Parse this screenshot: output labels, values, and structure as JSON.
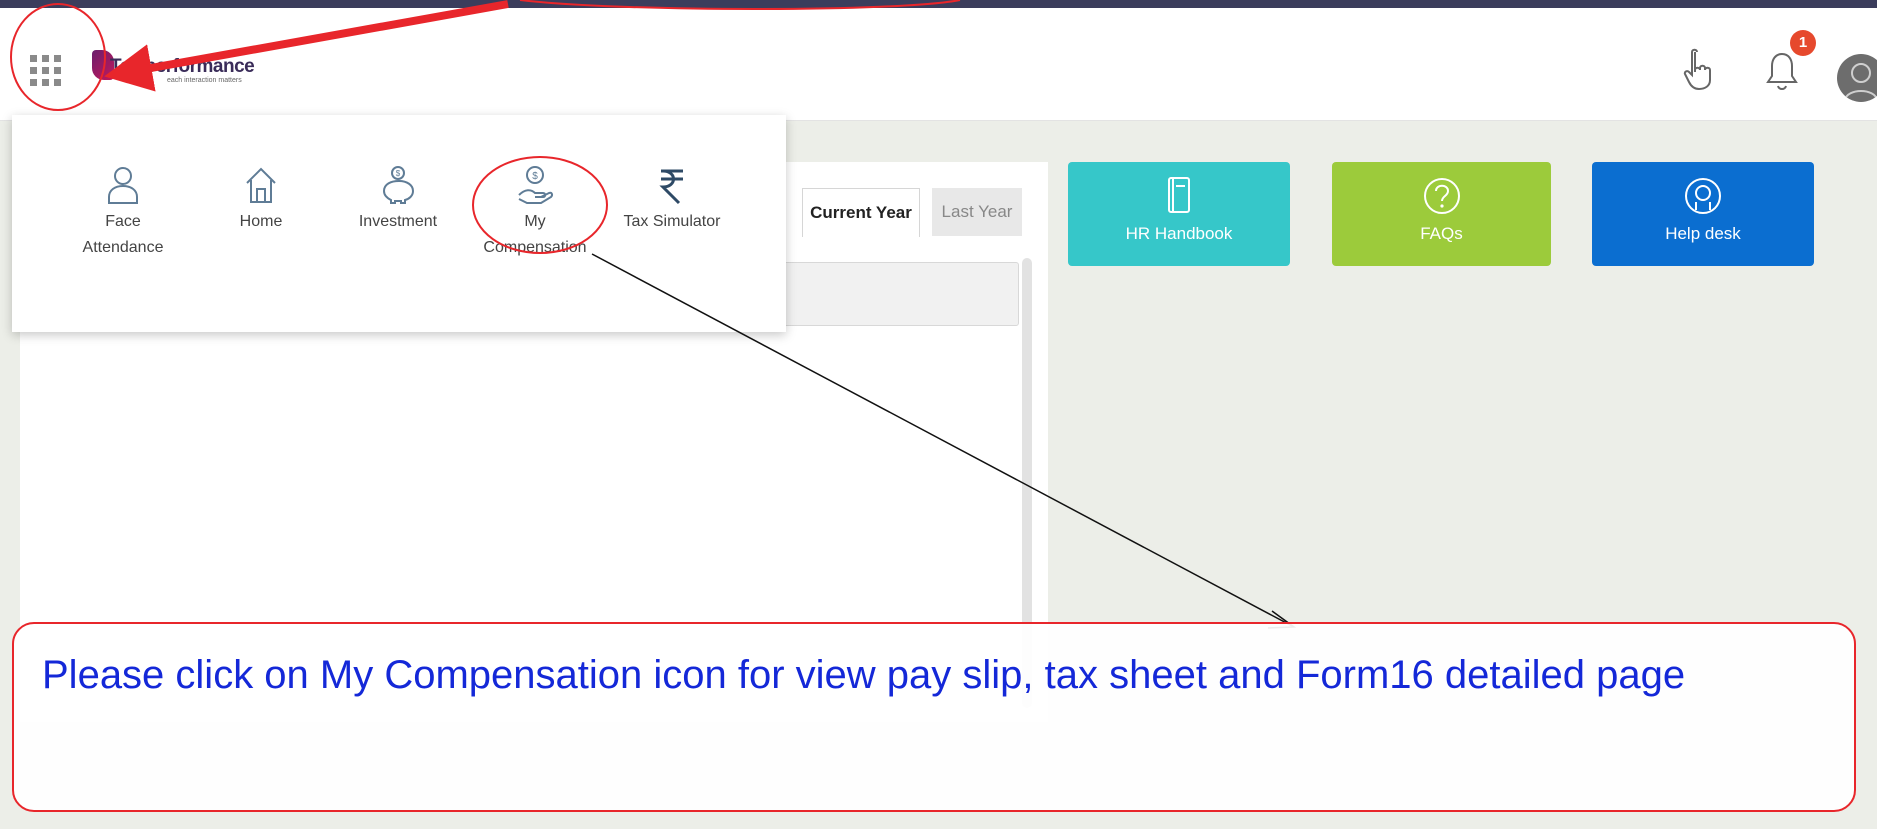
{
  "header": {
    "logo_text": "Teleperformance",
    "logo_tagline": "each interaction matters",
    "notification_count": "1"
  },
  "app_menu": {
    "items": [
      {
        "label_line1": "Face",
        "label_line2": "Attendance",
        "icon": "person-icon"
      },
      {
        "label_line1": "Home",
        "label_line2": "",
        "icon": "home-icon"
      },
      {
        "label_line1": "Investment",
        "label_line2": "",
        "icon": "piggy-bank-icon"
      },
      {
        "label_line1": "My",
        "label_line2": "Compensation",
        "icon": "hand-coin-icon"
      },
      {
        "label_line1": "Tax Simulator",
        "label_line2": "",
        "icon": "rupee-icon"
      }
    ]
  },
  "tabs": {
    "current_year": "Current Year",
    "last_year": "Last Year"
  },
  "tiles": [
    {
      "label": "HR Handbook",
      "icon": "book-icon",
      "color": "#36c7c9"
    },
    {
      "label": "FAQs",
      "icon": "question-icon",
      "color": "#9ccb3b"
    },
    {
      "label": "Help desk",
      "icon": "support-icon",
      "color": "#0b6ed0"
    }
  ],
  "callout": {
    "text": "Please click on My Compensation icon for view pay slip, tax sheet and Form16 detailed page"
  },
  "colors": {
    "annotation_red": "#e8262b",
    "callout_text_blue": "#1428d8",
    "top_strip": "#3b3d5c",
    "badge": "#e6492d"
  }
}
